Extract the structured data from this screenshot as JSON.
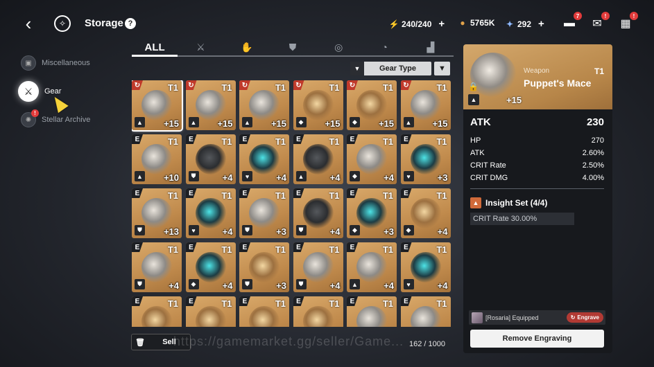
{
  "header": {
    "title": "Storage",
    "help": "?",
    "back_icon": "back-arrow-icon",
    "logo_icon": "storage-emblem-icon"
  },
  "currencies": [
    {
      "icon": "stamina-icon",
      "glyph": "⚡",
      "value": "240/240",
      "plus": "+"
    },
    {
      "icon": "coin-icon",
      "glyph": "●",
      "value": "5765K",
      "plus": ""
    },
    {
      "icon": "crystal-icon",
      "glyph": "✦",
      "value": "292",
      "plus": "+"
    }
  ],
  "top_icons": [
    {
      "name": "chat-icon",
      "glyph": "▬",
      "badge": "7"
    },
    {
      "name": "mail-icon",
      "glyph": "✉",
      "badge": "!"
    },
    {
      "name": "menu-grid-icon",
      "glyph": "▦",
      "badge": "!"
    }
  ],
  "nav": [
    {
      "label": "Miscellaneous",
      "icon": "box-icon",
      "active": false,
      "badge": ""
    },
    {
      "label": "Gear",
      "icon": "crossed-swords-icon",
      "active": true,
      "badge": ""
    },
    {
      "label": "Stellar Archive",
      "icon": "archive-icon",
      "active": false,
      "badge": "!"
    }
  ],
  "tabs": [
    {
      "label": "ALL",
      "icon": "all-tab",
      "active": true
    },
    {
      "label": "",
      "icon": "weapon-tab-icon",
      "glyph": "⚔"
    },
    {
      "label": "",
      "icon": "gloves-tab-icon",
      "glyph": "✋"
    },
    {
      "label": "",
      "icon": "armor-tab-icon",
      "glyph": "⛊"
    },
    {
      "label": "",
      "icon": "ring-tab-icon",
      "glyph": "◎"
    },
    {
      "label": "",
      "icon": "necklace-tab-icon",
      "glyph": "◔"
    },
    {
      "label": "",
      "icon": "boots-tab-icon",
      "glyph": "▟"
    }
  ],
  "filter": {
    "sort_label": "Gear Type",
    "sort_arrow": "▼",
    "filter_glyph": "▼"
  },
  "grid": [
    {
      "rank": "↻",
      "red": true,
      "tier": "T1",
      "level": "+15",
      "slot": "▲",
      "art": "silver",
      "selected": true
    },
    {
      "rank": "↻",
      "red": true,
      "tier": "T1",
      "level": "+15",
      "slot": "▲",
      "art": "silver"
    },
    {
      "rank": "↻",
      "red": true,
      "tier": "T1",
      "level": "+15",
      "slot": "▲",
      "art": "silver"
    },
    {
      "rank": "↻",
      "red": true,
      "tier": "T1",
      "level": "+15",
      "slot": "◆",
      "art": "gold"
    },
    {
      "rank": "↻",
      "red": true,
      "tier": "T1",
      "level": "+15",
      "slot": "◆",
      "art": "gold"
    },
    {
      "rank": "↻",
      "red": true,
      "tier": "T1",
      "level": "+15",
      "slot": "▲",
      "art": "silver"
    },
    {
      "rank": "E",
      "tier": "T1",
      "level": "+10",
      "slot": "▲",
      "art": "silver"
    },
    {
      "rank": "E",
      "tier": "T1",
      "level": "+4",
      "slot": "⛊",
      "art": "dark"
    },
    {
      "rank": "E",
      "tier": "T1",
      "level": "+4",
      "slot": "♥",
      "art": "teal"
    },
    {
      "rank": "E",
      "tier": "T1",
      "level": "+4",
      "slot": "▲",
      "art": "dark"
    },
    {
      "rank": "E",
      "tier": "T1",
      "level": "+4",
      "slot": "◆",
      "art": "silver"
    },
    {
      "rank": "E",
      "tier": "T1",
      "level": "+3",
      "slot": "♥",
      "art": "teal"
    },
    {
      "rank": "E",
      "tier": "T1",
      "level": "+13",
      "slot": "⛊",
      "art": "silver"
    },
    {
      "rank": "E",
      "tier": "T1",
      "level": "+4",
      "slot": "♥",
      "art": "teal"
    },
    {
      "rank": "E",
      "tier": "T1",
      "level": "+3",
      "slot": "⛊",
      "art": "silver"
    },
    {
      "rank": "E",
      "tier": "T1",
      "level": "+4",
      "slot": "⛊",
      "art": "dark"
    },
    {
      "rank": "E",
      "tier": "T1",
      "level": "+3",
      "slot": "◆",
      "art": "teal"
    },
    {
      "rank": "E",
      "tier": "T1",
      "level": "+4",
      "slot": "◆",
      "art": "gold"
    },
    {
      "rank": "E",
      "tier": "T1",
      "level": "+4",
      "slot": "⛊",
      "art": "silver"
    },
    {
      "rank": "E",
      "tier": "T1",
      "level": "+4",
      "slot": "◆",
      "art": "teal"
    },
    {
      "rank": "E",
      "tier": "T1",
      "level": "+3",
      "slot": "⛊",
      "art": "gold"
    },
    {
      "rank": "E",
      "tier": "T1",
      "level": "+4",
      "slot": "⛊",
      "art": "silver"
    },
    {
      "rank": "E",
      "tier": "T1",
      "level": "+4",
      "slot": "▲",
      "art": "silver"
    },
    {
      "rank": "E",
      "tier": "T1",
      "level": "+4",
      "slot": "♥",
      "art": "teal"
    },
    {
      "rank": "E",
      "tier": "T1",
      "level": "",
      "slot": "",
      "art": "gold"
    },
    {
      "rank": "E",
      "tier": "T1",
      "level": "",
      "slot": "",
      "art": "gold"
    },
    {
      "rank": "E",
      "tier": "T1",
      "level": "",
      "slot": "",
      "art": "gold"
    },
    {
      "rank": "E",
      "tier": "T1",
      "level": "",
      "slot": "",
      "art": "gold"
    },
    {
      "rank": "E",
      "tier": "T1",
      "level": "",
      "slot": "",
      "art": "silver"
    },
    {
      "rank": "E",
      "tier": "T1",
      "level": "",
      "slot": "",
      "art": "silver"
    }
  ],
  "footer": {
    "sell_label": "Sell",
    "capacity": "162 / 1000",
    "watermark": "https://gamemarket.gg/seller/Game..."
  },
  "detail": {
    "category": "Weapon",
    "tier": "T1",
    "name": "Puppet's Mace",
    "level": "+15",
    "main_stat": {
      "label": "ATK",
      "value": "230"
    },
    "sub_stats": [
      {
        "label": "HP",
        "value": "270"
      },
      {
        "label": "ATK",
        "value": "2.60%"
      },
      {
        "label": "CRIT Rate",
        "value": "2.50%"
      },
      {
        "label": "CRIT DMG",
        "value": "4.00%"
      }
    ],
    "set_name": "Insight Set (4/4)",
    "set_effect": "CRIT Rate 30.00%",
    "equipped_text": "[Rosaria] Equipped",
    "engrave_label": "Engrave",
    "remove_label": "Remove Engraving"
  }
}
